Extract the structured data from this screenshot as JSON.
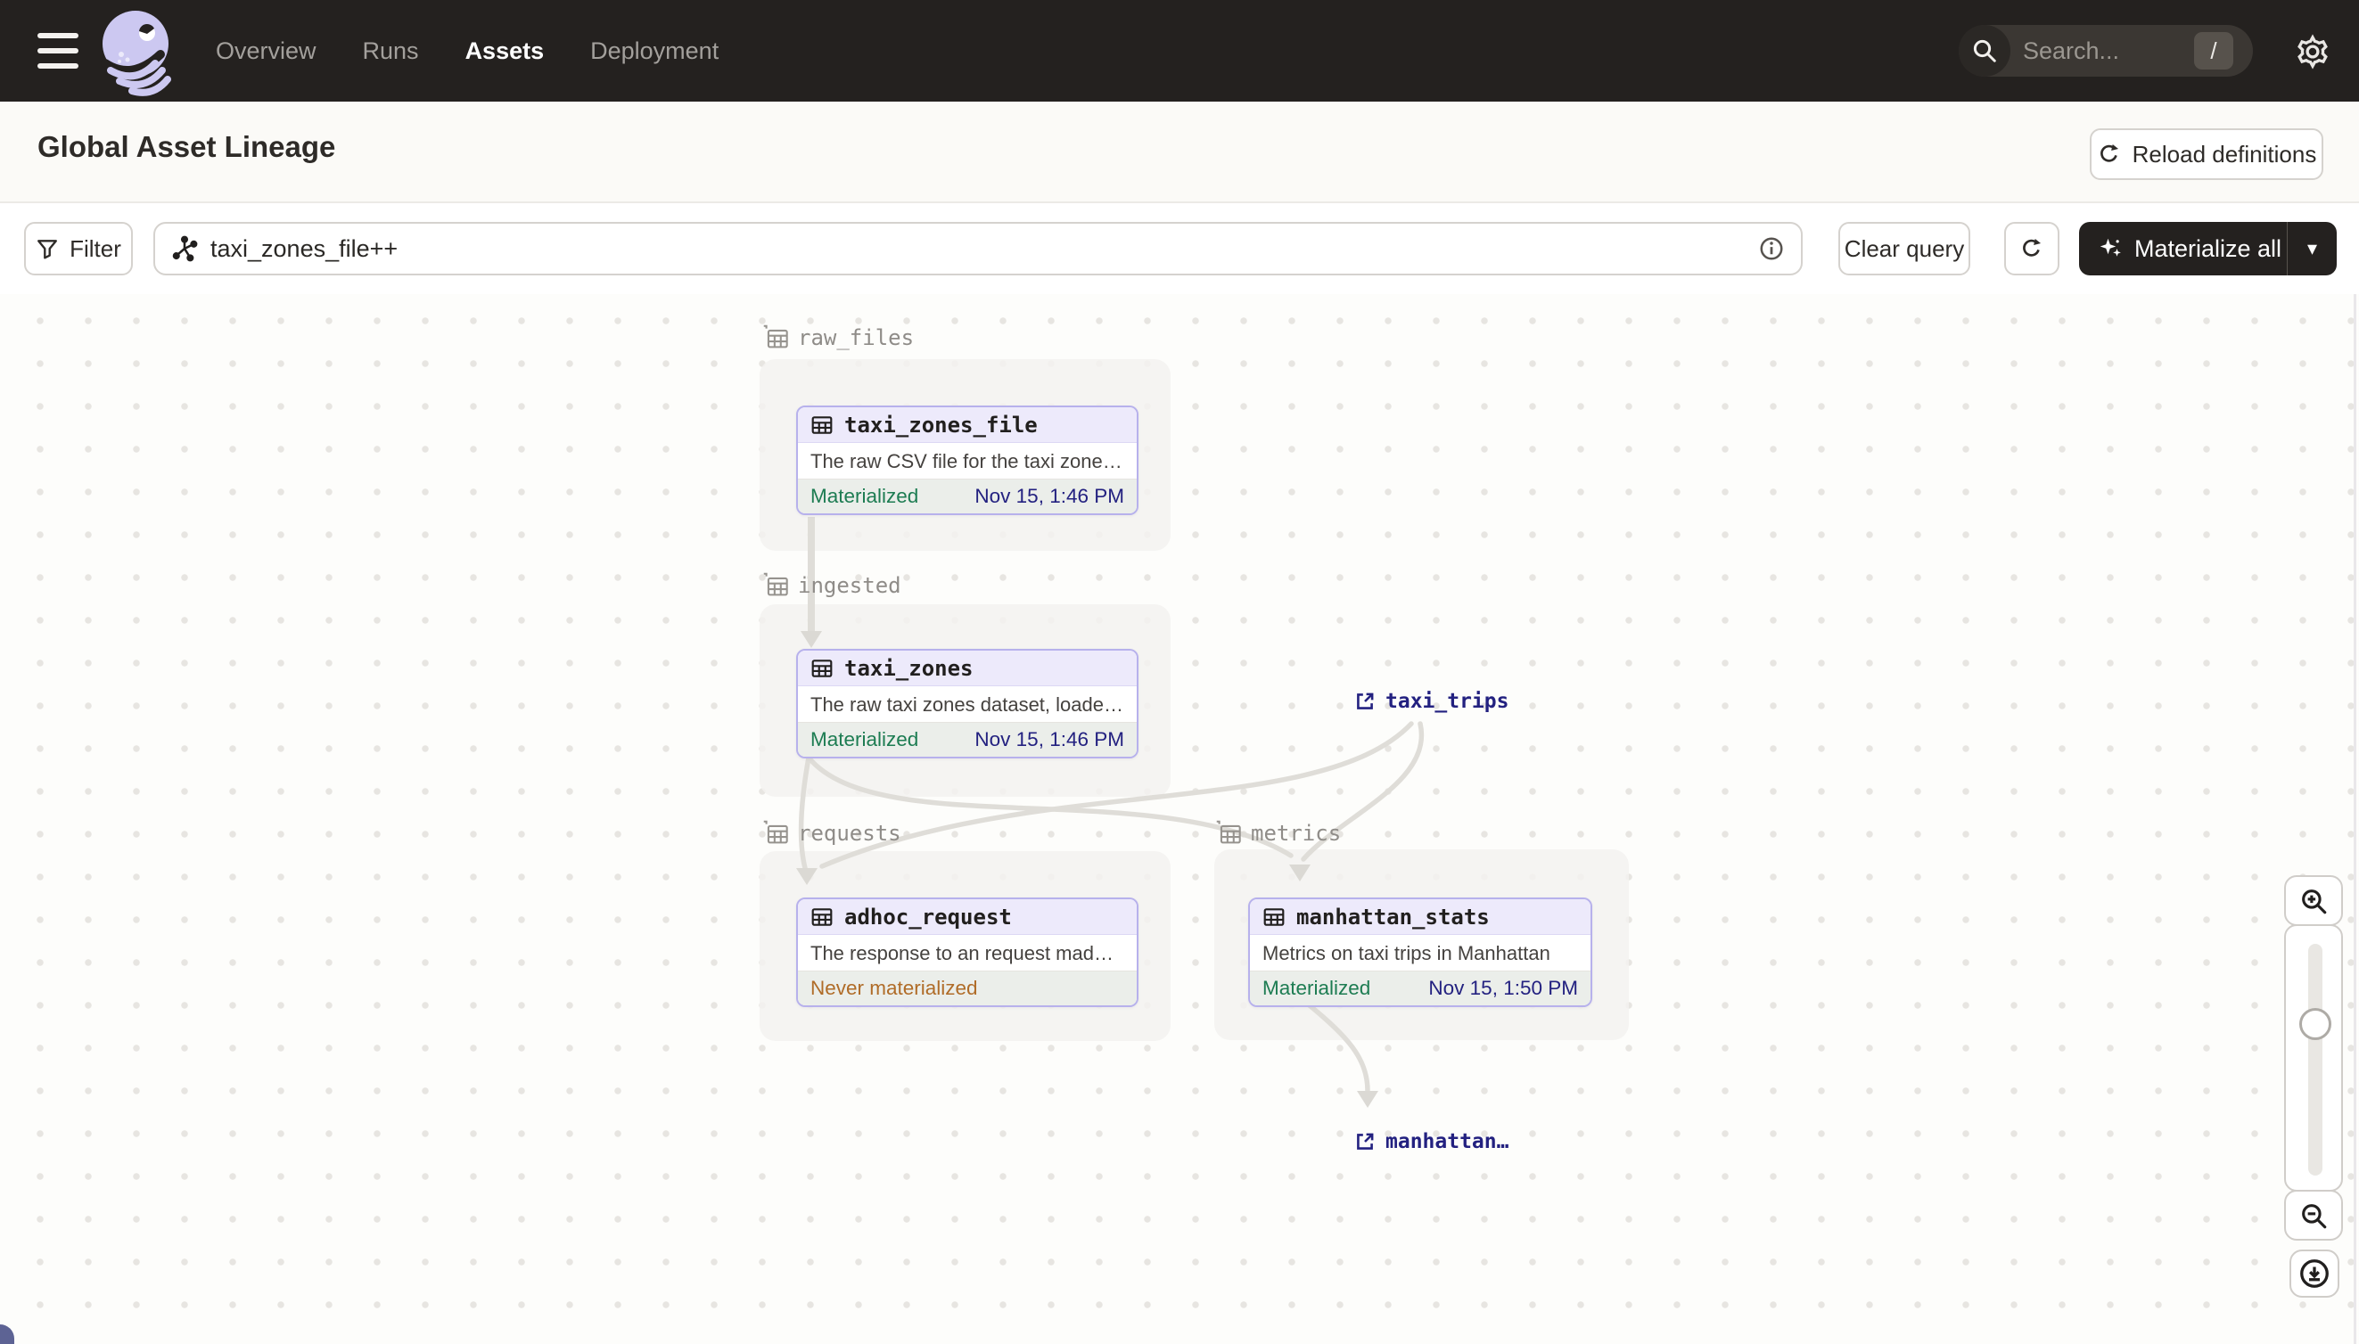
{
  "nav": {
    "menu": [
      "Overview",
      "Runs",
      "Assets",
      "Deployment"
    ],
    "active": "Assets",
    "search_placeholder": "Search...",
    "search_shortcut": "/"
  },
  "header": {
    "title": "Global Asset Lineage",
    "reload_label": "Reload definitions"
  },
  "toolbar": {
    "filter_label": "Filter",
    "query_value": "taxi_zones_file++",
    "clear_label": "Clear query",
    "materialize_label": "Materialize all"
  },
  "graph": {
    "groups": [
      {
        "name": "raw_files"
      },
      {
        "name": "ingested"
      },
      {
        "name": "requests"
      },
      {
        "name": "metrics"
      }
    ],
    "nodes": [
      {
        "name": "taxi_zones_file",
        "description": "The raw CSV file for the taxi zones dat...",
        "status": "Materialized",
        "timestamp": "Nov 15, 1:46 PM"
      },
      {
        "name": "taxi_zones",
        "description": "The raw taxi zones dataset, loaded int...",
        "status": "Materialized",
        "timestamp": "Nov 15, 1:46 PM"
      },
      {
        "name": "adhoc_request",
        "description": "The response to an request made in th...",
        "status": "Never materialized",
        "timestamp": ""
      },
      {
        "name": "manhattan_stats",
        "description": "Metrics on taxi trips in Manhattan",
        "status": "Materialized",
        "timestamp": "Nov 15, 1:50 PM"
      }
    ],
    "external_assets": [
      {
        "name": "taxi_trips"
      },
      {
        "name": "manhattan…"
      }
    ]
  },
  "icons": {
    "search": "magnifier",
    "settings": "gear",
    "filter": "funnel",
    "reload": "refresh-arrow",
    "materialize": "sparkle",
    "asset": "table-grid",
    "group": "stacked-tables",
    "external": "open-in-new",
    "zoom_in": "magnifier-plus",
    "zoom_out": "magnifier-minus",
    "export": "download-circle"
  },
  "colors": {
    "navbar_bg": "#24211f",
    "accent_purple": "#b7b1ec",
    "node_header_bg": "#edeafb",
    "status_green": "#1d7c52",
    "timestamp_navy": "#232180",
    "warn_orange": "#b06c28",
    "edge_gray": "#dfddd8",
    "logo_lavender": "#ccc8f1"
  }
}
